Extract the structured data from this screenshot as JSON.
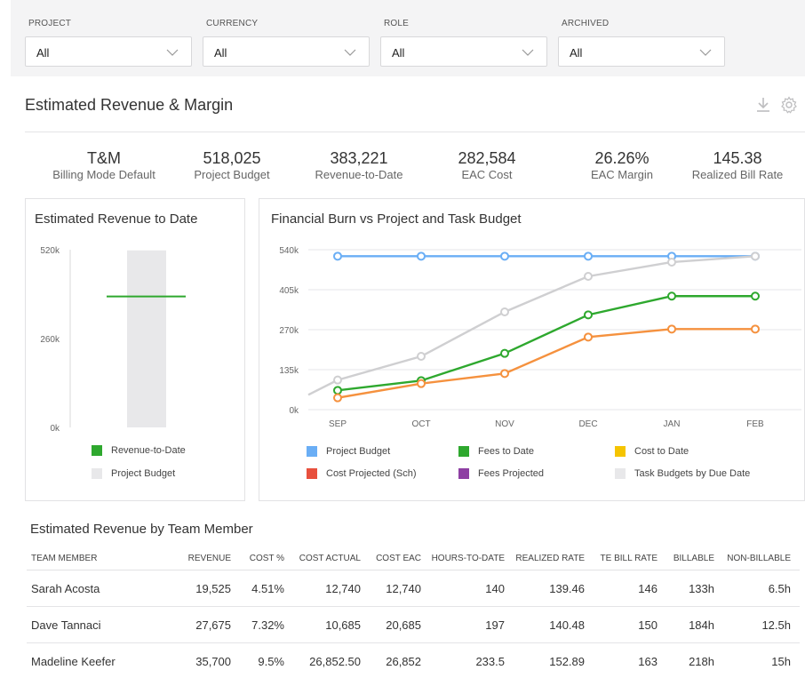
{
  "filters": [
    {
      "label": "PROJECT",
      "value": "All"
    },
    {
      "label": "CURRENCY",
      "value": "All"
    },
    {
      "label": "ROLE",
      "value": "All"
    },
    {
      "label": "ARCHIVED",
      "value": "All"
    }
  ],
  "header": {
    "title": "Estimated Revenue & Margin",
    "download_icon": "download-icon",
    "settings_icon": "gear-icon"
  },
  "kpis": [
    {
      "value": "T&M",
      "label": "Billing Mode Default"
    },
    {
      "value": "518,025",
      "label": "Project Budget"
    },
    {
      "value": "383,221",
      "label": "Revenue-to-Date"
    },
    {
      "value": "282,584",
      "label": "EAC Cost"
    },
    {
      "value": "26.26%",
      "label": "EAC Margin"
    },
    {
      "value": "145.38",
      "label": "Realized Bill Rate"
    }
  ],
  "revenue_card": {
    "title": "Estimated Revenue to Date",
    "legend": [
      {
        "label": "Revenue-to-Date",
        "color": "#2ea82e"
      },
      {
        "label": "Project Budget",
        "color": "#e8e8ea"
      }
    ]
  },
  "burn_card": {
    "title": "Financial Burn vs Project and Task Budget",
    "legend": [
      {
        "label": "Project Budget",
        "color": "#6aaef5"
      },
      {
        "label": "Fees to Date",
        "color": "#2ea82e"
      },
      {
        "label": "Cost to Date",
        "color": "#f5c400"
      },
      {
        "label": "Cost Projected (Sch)",
        "color": "#e8503e"
      },
      {
        "label": "Fees Projected",
        "color": "#8e3fa3"
      },
      {
        "label": "Task Budgets by Due Date",
        "color": "#e8e8ea"
      }
    ]
  },
  "chart_data": [
    {
      "type": "bar",
      "title": "Estimated Revenue to Date",
      "ylim": [
        0,
        520000
      ],
      "ytick_labels": [
        "0k",
        "260k",
        "520k"
      ],
      "ytick_values": [
        0,
        260000,
        520000
      ],
      "series": [
        {
          "name": "Project Budget",
          "values": [
            518025
          ],
          "color": "#e8e8ea"
        },
        {
          "name": "Revenue-to-Date",
          "values": [
            383221
          ],
          "color": "#2ea82e"
        }
      ],
      "legend_position": "bottom"
    },
    {
      "type": "line",
      "title": "Financial Burn vs Project and Task Budget",
      "categories": [
        "SEP",
        "OCT",
        "NOV",
        "DEC",
        "JAN",
        "FEB"
      ],
      "ylim": [
        0,
        540000
      ],
      "ytick_labels": [
        "0k",
        "135k",
        "270k",
        "405k",
        "540k"
      ],
      "ytick_values": [
        0,
        135000,
        270000,
        405000,
        540000
      ],
      "grid": true,
      "legend_position": "bottom",
      "series": [
        {
          "name": "Project Budget",
          "color": "#6aaef5",
          "values": [
            518025,
            518025,
            518025,
            518025,
            518025,
            518025
          ]
        },
        {
          "name": "Task Budgets by Due Date",
          "color": "#cfcfd1",
          "values": [
            100000,
            180000,
            330000,
            450000,
            498000,
            518025
          ],
          "lead": [
            0,
            50000
          ]
        },
        {
          "name": "Fees to Date",
          "color": "#2ea82e",
          "values": [
            65000,
            98000,
            190000,
            320000,
            383221,
            383221
          ]
        },
        {
          "name": "Cost Projected (Sch)",
          "color": "#f5913e",
          "values": [
            40000,
            88000,
            122000,
            245000,
            272000,
            272000
          ]
        }
      ]
    }
  ],
  "team_table": {
    "title": "Estimated Revenue by Team Member",
    "columns": [
      "TEAM MEMBER",
      "REVENUE",
      "COST %",
      "COST ACTUAL",
      "COST EAC",
      "HOURS-TO-DATE",
      "REALIZED RATE",
      "TE BILL RATE",
      "BILLABLE",
      "NON-BILLABLE"
    ],
    "rows": [
      [
        "Sarah Acosta",
        "19,525",
        "4.51%",
        "12,740",
        "12,740",
        "140",
        "139.46",
        "146",
        "133h",
        "6.5h"
      ],
      [
        "Dave Tannaci",
        "27,675",
        "7.32%",
        "10,685",
        "20,685",
        "197",
        "140.48",
        "150",
        "184h",
        "12.5h"
      ],
      [
        "Madeline Keefer",
        "35,700",
        "9.5%",
        "26,852.50",
        "26,852",
        "233.5",
        "152.89",
        "163",
        "218h",
        "15h"
      ]
    ]
  }
}
